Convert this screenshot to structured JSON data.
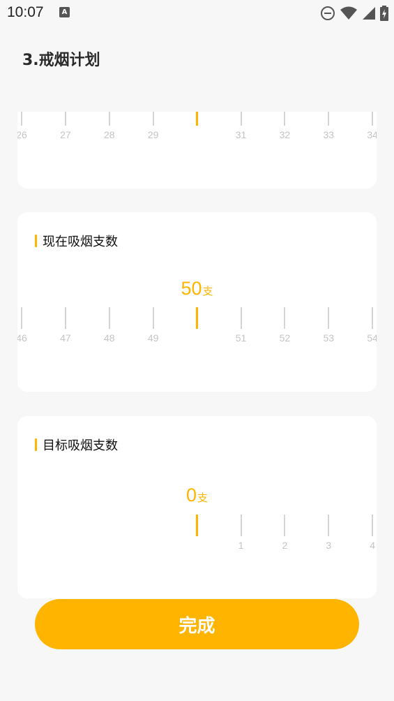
{
  "status_bar": {
    "time": "10:07",
    "app_icon_letter": "A",
    "icons": [
      "do-not-disturb-icon",
      "wifi-icon",
      "cellular-signal-icon",
      "battery-charging-icon"
    ]
  },
  "page": {
    "title": "3.戒烟计划"
  },
  "years_card": {
    "selected_value": 30,
    "tick_labels": [
      "26",
      "27",
      "28",
      "29",
      "",
      "31",
      "32",
      "33",
      "34"
    ]
  },
  "current_card": {
    "label": "现在吸烟支数",
    "value": "50",
    "unit": "支",
    "tick_labels": [
      "46",
      "47",
      "48",
      "49",
      "",
      "51",
      "52",
      "53",
      "54"
    ]
  },
  "target_card": {
    "label": "目标吸烟支数",
    "value": "0",
    "unit": "支",
    "tick_labels": [
      "",
      "1",
      "2",
      "3",
      "4"
    ]
  },
  "actions": {
    "done_label": "完成"
  },
  "colors": {
    "accent": "#ffb400",
    "tick": "#d4d4d4",
    "tick_label": "#c4c4c4",
    "background": "#f7f7f7",
    "card": "#ffffff"
  }
}
